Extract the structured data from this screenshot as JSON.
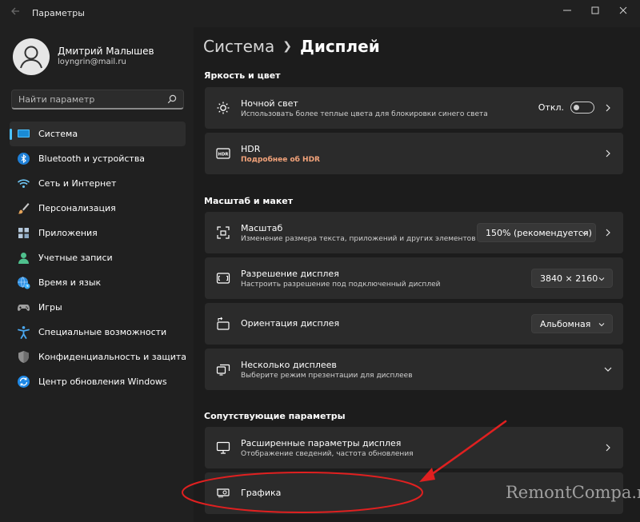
{
  "window": {
    "title": "Параметры",
    "back_icon": "arrow-left-icon",
    "controls": [
      "minimize-icon",
      "maximize-icon",
      "close-icon"
    ]
  },
  "profile": {
    "name": "Дмитрий Малышев",
    "email": "loyngrin@mail.ru"
  },
  "search": {
    "placeholder": "Найти параметр",
    "value": ""
  },
  "sidebar": {
    "items": [
      {
        "label": "Система",
        "icon": "monitor-icon",
        "selected": true
      },
      {
        "label": "Bluetooth и устройства",
        "icon": "bluetooth-icon"
      },
      {
        "label": "Сеть и Интернет",
        "icon": "wifi-icon"
      },
      {
        "label": "Персонализация",
        "icon": "brush-icon"
      },
      {
        "label": "Приложения",
        "icon": "apps-icon"
      },
      {
        "label": "Учетные записи",
        "icon": "user-icon"
      },
      {
        "label": "Время и язык",
        "icon": "globe-clock-icon"
      },
      {
        "label": "Игры",
        "icon": "gamepad-icon"
      },
      {
        "label": "Специальные возможности",
        "icon": "accessibility-icon"
      },
      {
        "label": "Конфиденциальность и защита",
        "icon": "shield-icon"
      },
      {
        "label": "Центр обновления Windows",
        "icon": "update-icon"
      }
    ]
  },
  "breadcrumb": {
    "parent": "Система",
    "current": "Дисплей"
  },
  "sections": {
    "brightness": {
      "title": "Яркость и цвет",
      "night_light": {
        "title": "Ночной свет",
        "subtitle": "Использовать более теплые цвета для блокировки синего света",
        "toggle_label": "Откл.",
        "toggle_on": false,
        "icon": "sun-icon"
      },
      "hdr": {
        "title": "HDR",
        "link": "Подробнее об HDR",
        "icon": "hdr-icon"
      }
    },
    "scale_layout": {
      "title": "Масштаб и макет",
      "scale": {
        "title": "Масштаб",
        "subtitle": "Изменение размера текста, приложений и других элементов",
        "value": "150% (рекомендуется)",
        "icon": "scale-icon"
      },
      "resolution": {
        "title": "Разрешение дисплея",
        "subtitle": "Настроить разрешение под подключенный дисплей",
        "value": "3840 × 2160",
        "icon": "resolution-icon"
      },
      "orientation": {
        "title": "Ориентация дисплея",
        "value": "Альбомная",
        "icon": "orientation-icon"
      },
      "multiple": {
        "title": "Несколько дисплеев",
        "subtitle": "Выберите режим презентации для дисплеев",
        "icon": "multiple-displays-icon"
      }
    },
    "related": {
      "title": "Сопутствующие параметры",
      "advanced": {
        "title": "Расширенные параметры дисплея",
        "subtitle": "Отображение сведений, частота обновления",
        "icon": "monitor-icon"
      },
      "graphics": {
        "title": "Графика",
        "icon": "graphics-card-icon"
      }
    }
  },
  "watermark": "RemontCompa.ru",
  "colors": {
    "accent": "#4cc2ff",
    "annotation": "#e02020",
    "link": "#f3a37a"
  }
}
